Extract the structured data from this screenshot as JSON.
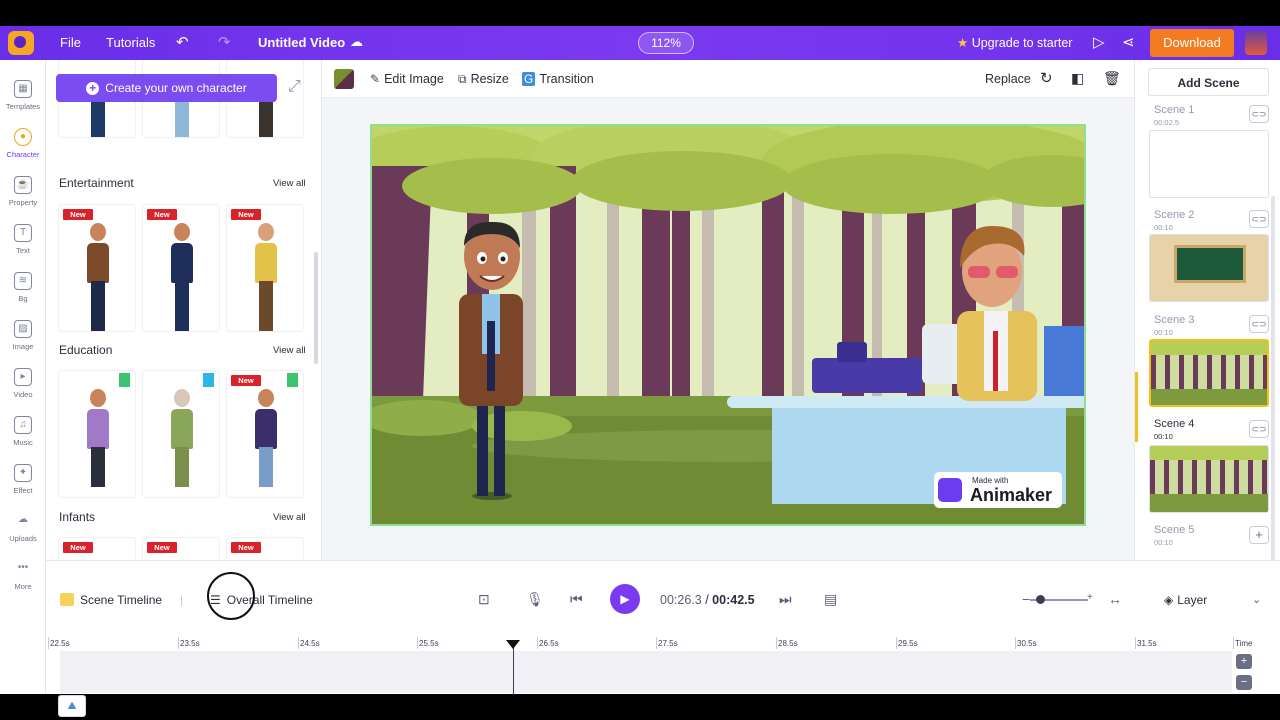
{
  "topbar": {
    "file": "File",
    "tutorials": "Tutorials",
    "title": "Untitled Video",
    "zoom": "112%",
    "upgrade": "Upgrade to starter",
    "download": "Download"
  },
  "rail": [
    {
      "label": "Templates",
      "icon": "templates-icon"
    },
    {
      "label": "Character",
      "icon": "character-icon"
    },
    {
      "label": "Property",
      "icon": "property-icon"
    },
    {
      "label": "Text",
      "icon": "text-icon"
    },
    {
      "label": "Bg",
      "icon": "bg-icon"
    },
    {
      "label": "Image",
      "icon": "image-icon"
    },
    {
      "label": "Video",
      "icon": "video-icon"
    },
    {
      "label": "Music",
      "icon": "music-icon"
    },
    {
      "label": "Effect",
      "icon": "effect-icon"
    },
    {
      "label": "Uploads",
      "icon": "uploads-icon"
    },
    {
      "label": "More",
      "icon": "more-icon"
    }
  ],
  "panel": {
    "create_label": "Create your own character",
    "sections": [
      {
        "title": "Entertainment",
        "view_all": "View all"
      },
      {
        "title": "Education",
        "view_all": "View all"
      },
      {
        "title": "Infants",
        "view_all": "View all"
      }
    ],
    "badge": "New"
  },
  "toolbar": {
    "edit_image": "Edit Image",
    "resize": "Resize",
    "transition": "Transition",
    "replace": "Replace"
  },
  "canvas": {
    "watermark_small": "Made with",
    "watermark_big": "Animaker"
  },
  "scenes": {
    "add_label": "Add Scene",
    "items": [
      {
        "name": "Scene 1",
        "duration": "00:02.5"
      },
      {
        "name": "Scene 2",
        "duration": "00:10"
      },
      {
        "name": "Scene 3",
        "duration": "00:10"
      },
      {
        "name": "Scene 4",
        "duration": "00:10"
      },
      {
        "name": "Scene 5",
        "duration": "00:10"
      }
    ]
  },
  "timeline": {
    "scene_timeline": "Scene Timeline",
    "overall_timeline": "Overall Timeline",
    "current": "00:26.3",
    "separator": "/",
    "total": "00:42.5",
    "layer": "Layer",
    "time_label": "Time",
    "ticks": [
      "22.5s",
      "23.5s",
      "24.5s",
      "25.5s",
      "26.5s",
      "27.5s",
      "28.5s",
      "29.5s",
      "30.5s",
      "31.5s"
    ]
  },
  "colors": {
    "brand_purple": "#7b3af0",
    "download_orange": "#f27c1f",
    "new_badge": "#d8232a",
    "selection_green": "#8ee08e"
  }
}
